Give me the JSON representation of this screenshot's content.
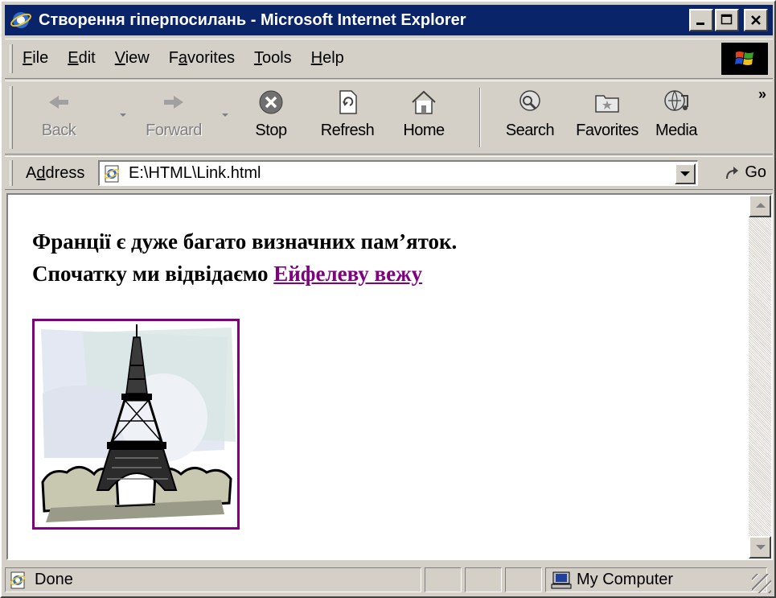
{
  "window": {
    "title": "Створення гіперпосилань - Microsoft Internet Explorer",
    "title_icon": "ie-icon",
    "controls": [
      "minimize-icon",
      "maximize-icon",
      "close-icon"
    ]
  },
  "menu": {
    "items": [
      {
        "label": "File",
        "accel": "F",
        "rest": "ile"
      },
      {
        "label": "Edit",
        "accel": "E",
        "rest": "dit"
      },
      {
        "label": "View",
        "accel": "V",
        "rest": "iew"
      },
      {
        "label": "Favorites",
        "pre": "F",
        "accel": "a",
        "rest": "vorites"
      },
      {
        "label": "Tools",
        "accel": "T",
        "rest": "ools"
      },
      {
        "label": "Help",
        "accel": "H",
        "rest": "elp"
      }
    ]
  },
  "toolbar": {
    "back": "Back",
    "forward": "Forward",
    "stop": "Stop",
    "refresh": "Refresh",
    "home": "Home",
    "search": "Search",
    "favorites": "Favorites",
    "media": "Media",
    "more": "»"
  },
  "address": {
    "label_pre": "A",
    "label_accel": "d",
    "label_rest": "dress",
    "value": "E:\\HTML\\Link.html",
    "go": "Go"
  },
  "page": {
    "line1": "Франції є дуже багато визначних пам’яток.",
    "line2": "Спочатку ми відвідаємо ",
    "link": "Ейфелеву вежу"
  },
  "status": {
    "text": "Done",
    "zone": "My Computer"
  },
  "colors": {
    "titlebar": "#0a246a",
    "chrome": "#d4d0c8",
    "visited_link": "#800080"
  }
}
